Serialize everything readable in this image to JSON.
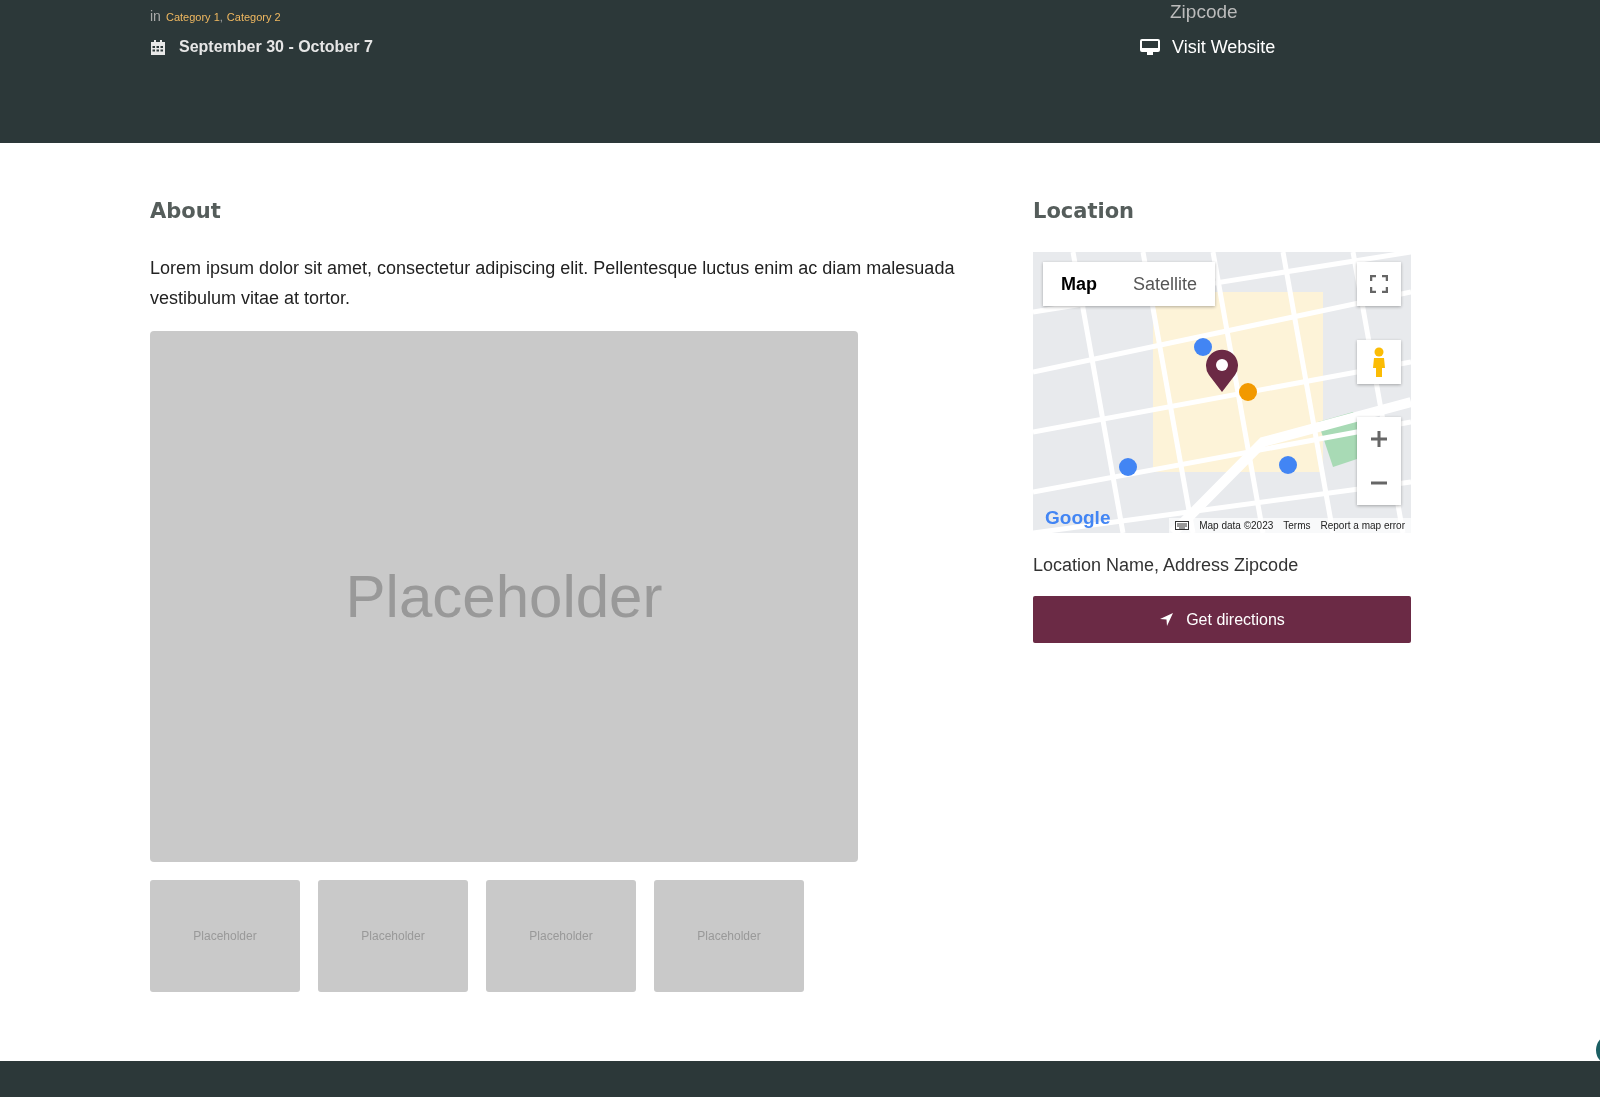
{
  "header": {
    "categories_prefix": "in",
    "categories": [
      "Category 1",
      "Category 2"
    ],
    "separator": ",",
    "date": "September 30 - October 7",
    "address_tail": "Zipcode",
    "website_link": "Visit Website"
  },
  "about": {
    "heading": "About",
    "text": "Lorem ipsum dolor sit amet, consectetur adipiscing elit. Pellentesque luctus enim ac diam malesuada vestibulum vitae at tortor.",
    "main_image": {
      "label": "Placeholder"
    },
    "thumbnails": [
      {
        "label": "Placeholder"
      },
      {
        "label": "Placeholder"
      },
      {
        "label": "Placeholder"
      },
      {
        "label": "Placeholder"
      }
    ]
  },
  "location": {
    "heading": "Location",
    "map": {
      "kind": "picture",
      "map_types": [
        {
          "label": "Map",
          "selected": true
        },
        {
          "label": "Satellite",
          "selected": false
        }
      ],
      "logo": "Google",
      "attribution": "Map data ©2023",
      "links": [
        "Terms",
        "Report a map error"
      ]
    },
    "address": "Location Name, Address Zipcode",
    "directions_button": "Get directions"
  }
}
